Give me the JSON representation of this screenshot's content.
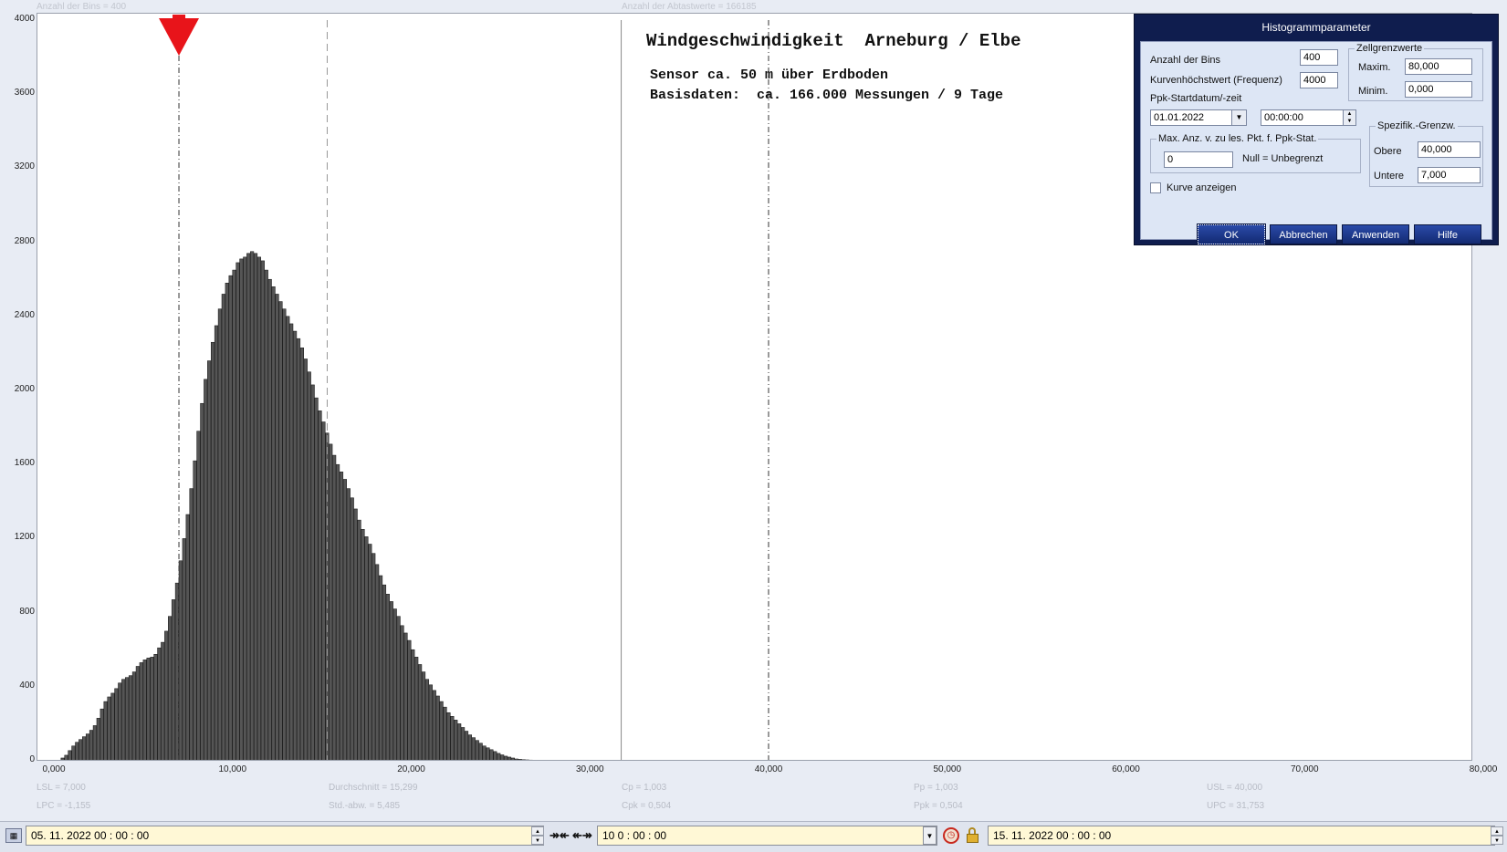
{
  "top_hints": {
    "bins": "Anzahl der Bins = 400",
    "samples": "Anzahl der Abtastwerte = 166185"
  },
  "chart_data": {
    "type": "bar",
    "title": "Windgeschwindigkeit  Arneburg / Elbe",
    "subtitle_lines": [
      "Sensor ca. 50 m über Erdboden",
      "Basisdaten:  ca. 166.000 Messungen / 9 Tage"
    ],
    "xlim": [
      0,
      80
    ],
    "ylim": [
      0,
      4000
    ],
    "y_ticks": [
      "4000",
      "3600",
      "3200",
      "2800",
      "2400",
      "2000",
      "1600",
      "1200",
      "800",
      "400",
      "0"
    ],
    "x_ticks": [
      "0,000",
      "10,000",
      "20,000",
      "30,000",
      "40,000",
      "50,000",
      "60,000",
      "70,000",
      "80,000"
    ],
    "bin_width": 0.2,
    "bin_start": 0.0,
    "values": [
      0,
      0,
      15,
      30,
      55,
      80,
      100,
      115,
      130,
      145,
      165,
      190,
      230,
      280,
      320,
      345,
      365,
      390,
      420,
      440,
      450,
      460,
      480,
      510,
      530,
      545,
      555,
      560,
      575,
      610,
      640,
      700,
      780,
      870,
      960,
      1080,
      1200,
      1330,
      1470,
      1620,
      1780,
      1930,
      2060,
      2160,
      2260,
      2350,
      2440,
      2520,
      2580,
      2620,
      2650,
      2690,
      2710,
      2720,
      2740,
      2750,
      2740,
      2720,
      2700,
      2650,
      2600,
      2560,
      2520,
      2480,
      2440,
      2400,
      2360,
      2320,
      2280,
      2230,
      2170,
      2100,
      2030,
      1960,
      1890,
      1830,
      1770,
      1710,
      1650,
      1600,
      1560,
      1520,
      1470,
      1420,
      1360,
      1300,
      1250,
      1210,
      1170,
      1120,
      1060,
      1000,
      950,
      900,
      860,
      820,
      780,
      730,
      690,
      650,
      600,
      560,
      520,
      480,
      440,
      410,
      380,
      350,
      320,
      290,
      260,
      240,
      220,
      200,
      180,
      160,
      140,
      125,
      110,
      95,
      80,
      70,
      60,
      50,
      40,
      32,
      25,
      20,
      15,
      10,
      8,
      6,
      5,
      4,
      3,
      3,
      2,
      2,
      1,
      1,
      1,
      1,
      0,
      0,
      0,
      0,
      1
    ],
    "vlines": [
      {
        "name": "LSL",
        "x": 7.0,
        "style": "dashdot",
        "color": "#333333"
      },
      {
        "name": "Mittelwert",
        "x": 15.299,
        "style": "dash",
        "color": "#999999"
      },
      {
        "name": "UPC",
        "x": 31.753,
        "style": "solid",
        "color": "#888888"
      },
      {
        "name": "USL",
        "x": 40.0,
        "style": "dashdot",
        "color": "#333333"
      }
    ],
    "marker": {
      "x": 7.0,
      "color": "#e8141a",
      "shape": "triangle-down"
    },
    "bar_color": "#555555"
  },
  "stats": {
    "lsl": "LSL = 7,000",
    "lpc": "LPC = -1,155",
    "mean": "Durchschnitt = 15,299",
    "std": "Std.-abw. = 5,485",
    "cp": "Cp = 1,003",
    "cpk": "Cpk = 0,504",
    "pp": "Pp = 1,003",
    "ppk": "Ppk = 0,504",
    "usl": "USL = 40,000",
    "upc": "UPC = 31,753"
  },
  "dialog": {
    "title": "Histogrammparameter",
    "bins_label": "Anzahl der Bins",
    "bins_value": "400",
    "peak_label": "Kurvenhöchstwert (Frequenz)",
    "peak_value": "4000",
    "ppk_start_label": "Ppk-Startdatum/-zeit",
    "ppk_date": "01.01.2022",
    "ppk_time": "00:00:00",
    "cell_group_label": "Zellgrenzwerte",
    "max_label": "Maxim.",
    "max_value": "80,000",
    "min_label": "Minim.",
    "min_value": "0,000",
    "maxcount_group_label": "Max. Anz. v. zu les. Pkt. f. Ppk-Stat.",
    "maxcount_value": "0",
    "null_hint": "Null = Unbegrenzt",
    "spec_group_label": "Spezifik.-Grenzw.",
    "upper_label": "Obere",
    "upper_value": "40,000",
    "lower_label": "Untere",
    "lower_value": "7,000",
    "show_curve_label": "Kurve anzeigen",
    "show_curve_checked": false,
    "buttons": {
      "ok": "OK",
      "cancel": "Abbrechen",
      "apply": "Anwenden",
      "help": "Hilfe"
    }
  },
  "bottombar": {
    "start": "05. 11. 2022    00 : 00 : 00",
    "span": "10  0 : 00 : 00",
    "end": "15. 11. 2022    00 : 00 : 00",
    "arrows1": "↠↞",
    "arrows2": "↞↠"
  }
}
